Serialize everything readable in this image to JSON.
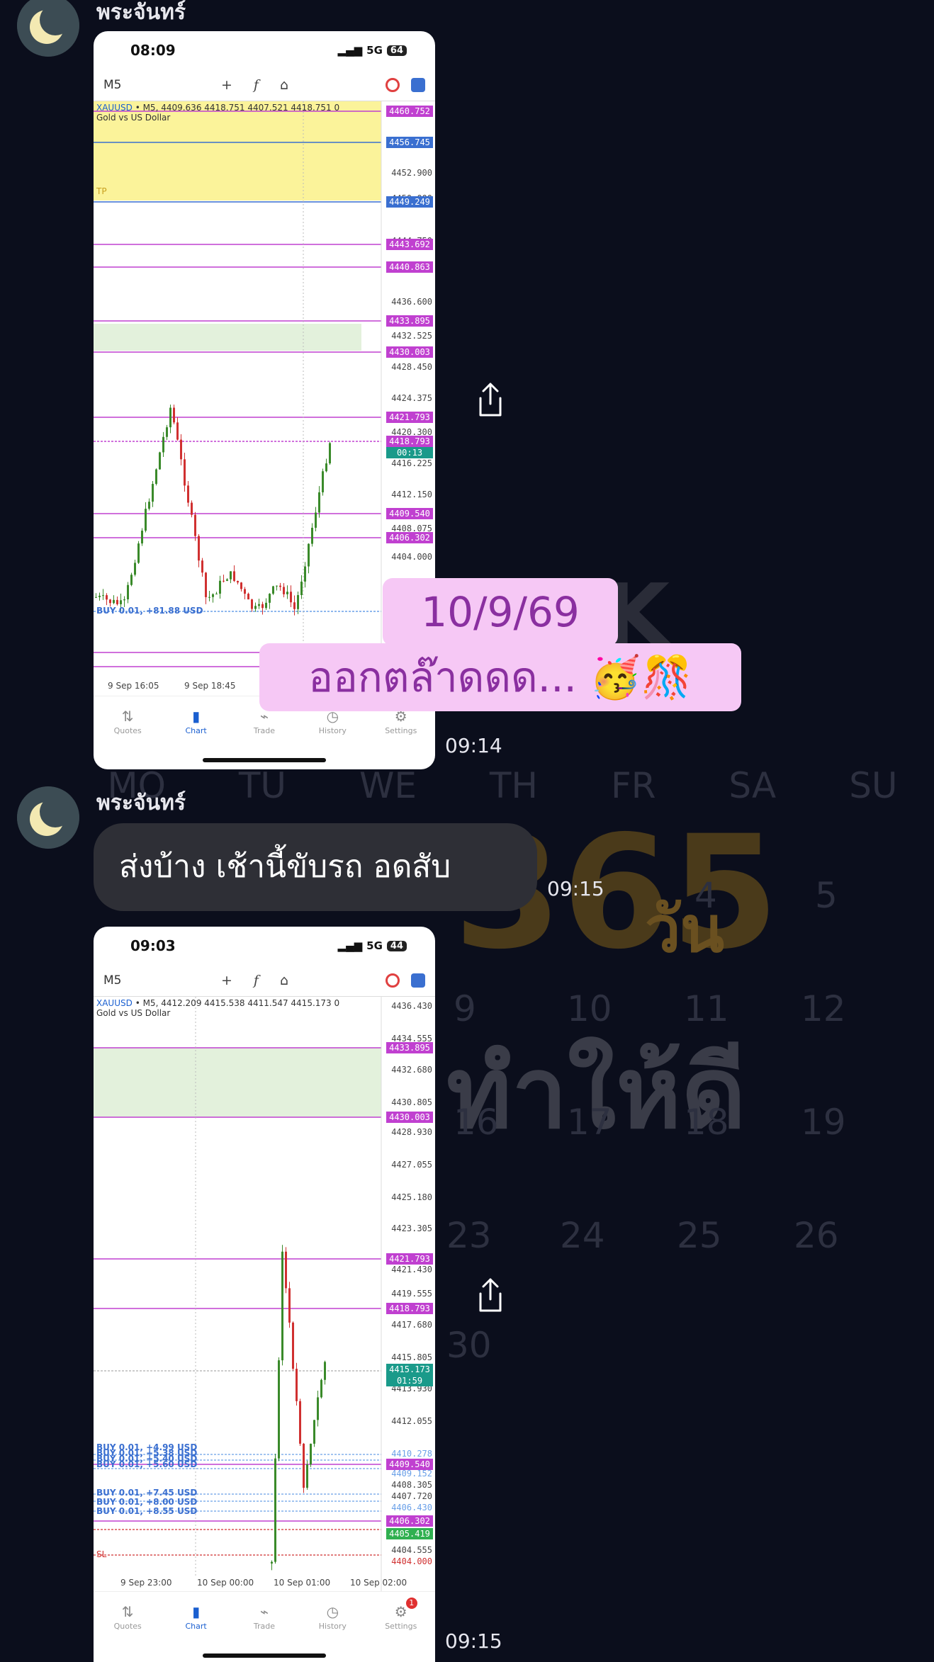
{
  "background": {
    "weekdays": [
      "MO",
      "TU",
      "WE",
      "TH",
      "FR",
      "SA",
      "SU"
    ],
    "big_number": "365",
    "big_number_suffix": "วัน",
    "slogan": "ทำให้ดี",
    "day_cells": [
      "4",
      "5",
      "9",
      "10",
      "11",
      "12",
      "16",
      "17",
      "18",
      "19",
      "23",
      "24",
      "25",
      "26",
      "30"
    ]
  },
  "messages": [
    {
      "sender": "พระจันทร์",
      "type": "screenshot",
      "time": "09:14",
      "phone": {
        "clock": "08:09",
        "network": "5G",
        "battery": "64",
        "timeframe": "M5",
        "symbol": "XAUUSD",
        "ohlc": "• M5, 4409.636 4418.751 4407.521 4418.751 0",
        "name": "Gold vs US Dollar",
        "tp_label": "TP",
        "price_tags": [
          "4460.752",
          "4456.745",
          "4449.249",
          "4443.692",
          "4440.863",
          "4433.895",
          "4430.003",
          "4421.793",
          "4418.793",
          "4409.540",
          "4406.302"
        ],
        "countdown": "00:13",
        "ticks": [
          "4452.900",
          "4450.000",
          "4444.750",
          "4436.600",
          "4432.525",
          "4428.450",
          "4424.375",
          "4420.300",
          "4416.225",
          "4412.150",
          "4408.075",
          "4404.000"
        ],
        "buy_line": "BUY 0.01, +81.88 USD",
        "time_labels": [
          "9 Sep 16:05",
          "9 Sep 18:45"
        ]
      }
    },
    {
      "type": "sticker",
      "line1": "10/9/69",
      "line2": "ออกตล๊าดดด... 🥳🎊"
    },
    {
      "sender": "พระจันทร์",
      "type": "text",
      "text": "ส่งบ้าง เช้านี้ขับรถ อดสับ",
      "time": "09:15"
    },
    {
      "sender": "",
      "type": "screenshot",
      "time": "09:15",
      "phone": {
        "clock": "09:03",
        "network": "5G",
        "battery": "44",
        "timeframe": "M5",
        "symbol": "XAUUSD",
        "ohlc": "• M5, 4412.209 4415.538 4411.547 4415.173 0",
        "name": "Gold vs US Dollar",
        "price_tags": [
          "4433.895",
          "4430.003",
          "4421.793",
          "4418.793",
          "4415.173",
          "4409.540",
          "4406.302",
          "4405.419"
        ],
        "countdown": "01:59",
        "ticks": [
          "4436.430",
          "4434.555",
          "4432.680",
          "4430.805",
          "4428.930",
          "4427.055",
          "4425.180",
          "4423.305",
          "4421.430",
          "4419.555",
          "4417.680",
          "4415.805",
          "4413.930",
          "4412.055",
          "4410.278",
          "4409.152",
          "4408.305",
          "4407.720",
          "4406.430",
          "4404.555",
          "4404.000"
        ],
        "buy_lines": [
          "BUY 0.01, +4.99 USD",
          "BUY 0.01, +5.38 USD",
          "BUY 0.01, +5.40 USD",
          "BUY 0.01, +5.60 USD",
          "BUY 0.01, +7.45 USD",
          "BUY 0.01, +8.00 USD",
          "BUY 0.01, +8.55 USD"
        ],
        "sl_label": "SL",
        "time_labels": [
          "9 Sep 23:00",
          "10 Sep 00:00",
          "10 Sep 01:00",
          "10 Sep 02:00"
        ],
        "settings_badge": "1"
      }
    }
  ],
  "tabs": [
    "Quotes",
    "Chart",
    "Trade",
    "History",
    "Settings"
  ],
  "colors": {
    "accent": "#1a5fd0",
    "magenta": "#c040d0",
    "bull": "#3a8a2a",
    "bear": "#d03030",
    "tp_zone": "#fbf39a",
    "range_zone": "#e3f1dc"
  }
}
